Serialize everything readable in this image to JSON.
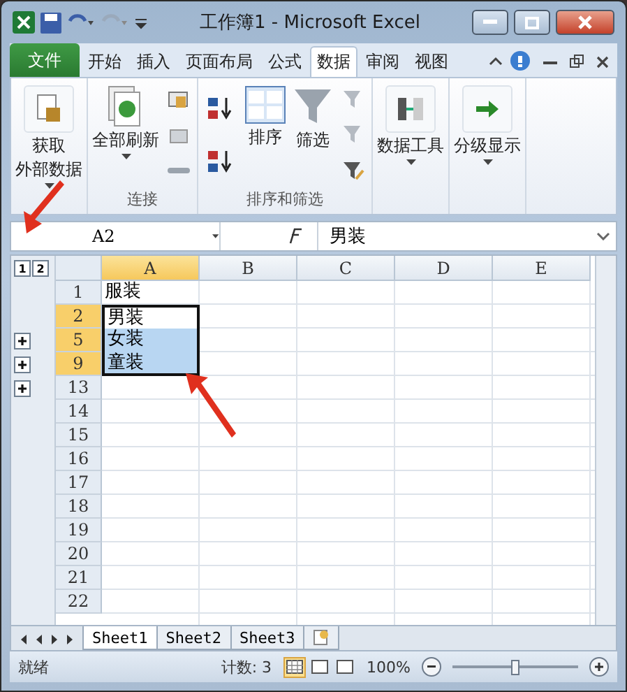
{
  "window": {
    "title": "工作簿1 - Microsoft Excel"
  },
  "file_tab": {
    "label": "文件"
  },
  "tabs": [
    {
      "label": "开始",
      "selected": false
    },
    {
      "label": "插入",
      "selected": false
    },
    {
      "label": "页面布局",
      "selected": false
    },
    {
      "label": "公式",
      "selected": false
    },
    {
      "label": "数据",
      "selected": true
    },
    {
      "label": "审阅",
      "selected": false
    },
    {
      "label": "视图",
      "selected": false
    }
  ],
  "ribbon": {
    "groups": [
      {
        "buttons": [
          {
            "kind": "large",
            "lines": [
              "获取",
              "外部数据"
            ],
            "dropdown": true
          }
        ]
      },
      {
        "label": "连接",
        "buttons": [
          {
            "kind": "large",
            "lines": [
              "全部刷新"
            ],
            "dropdown": true
          },
          {
            "kind": "smallstack"
          }
        ]
      },
      {
        "label": "排序和筛选",
        "buttons": [
          {
            "kind": "sortstack"
          },
          {
            "kind": "large",
            "lines": [
              "排序"
            ],
            "dropdown": false
          },
          {
            "kind": "large",
            "lines": [
              "筛选"
            ],
            "dropdown": false
          },
          {
            "kind": "smallstack"
          }
        ]
      },
      {
        "buttons": [
          {
            "kind": "large",
            "lines": [
              "数据工具"
            ],
            "dropdown": true
          }
        ]
      },
      {
        "buttons": [
          {
            "kind": "large",
            "lines": [
              "分级显示"
            ],
            "dropdown": true
          }
        ]
      }
    ]
  },
  "formula_bar": {
    "name_box": "A2",
    "value": "男装"
  },
  "outline": {
    "levels": [
      "1",
      "2"
    ]
  },
  "columns": [
    {
      "label": "A",
      "selected": true
    },
    {
      "label": "B",
      "selected": false
    },
    {
      "label": "C",
      "selected": false
    },
    {
      "label": "D",
      "selected": false
    },
    {
      "label": "E",
      "selected": false
    }
  ],
  "rows": [
    {
      "label": "1",
      "selected": false,
      "collapsed": false,
      "cell": "服装",
      "cell_selected": false
    },
    {
      "label": "2",
      "selected": true,
      "collapsed": false,
      "cell": "男装",
      "cell_selected": true
    },
    {
      "label": "5",
      "selected": true,
      "collapsed": true,
      "cell": "女装",
      "cell_selected": true
    },
    {
      "label": "9",
      "selected": true,
      "collapsed": true,
      "cell": "童装",
      "cell_selected": true
    },
    {
      "label": "13",
      "selected": false,
      "collapsed": true,
      "cell": "",
      "cell_selected": false
    },
    {
      "label": "14",
      "selected": false,
      "collapsed": false,
      "cell": "",
      "cell_selected": false
    },
    {
      "label": "15",
      "selected": false,
      "collapsed": false,
      "cell": "",
      "cell_selected": false
    },
    {
      "label": "16",
      "selected": false,
      "collapsed": false,
      "cell": "",
      "cell_selected": false
    },
    {
      "label": "17",
      "selected": false,
      "collapsed": false,
      "cell": "",
      "cell_selected": false
    },
    {
      "label": "18",
      "selected": false,
      "collapsed": false,
      "cell": "",
      "cell_selected": false
    },
    {
      "label": "19",
      "selected": false,
      "collapsed": false,
      "cell": "",
      "cell_selected": false
    },
    {
      "label": "20",
      "selected": false,
      "collapsed": false,
      "cell": "",
      "cell_selected": false
    },
    {
      "label": "21",
      "selected": false,
      "collapsed": false,
      "cell": "",
      "cell_selected": false
    },
    {
      "label": "22",
      "selected": false,
      "collapsed": false,
      "cell": "",
      "cell_selected": false
    }
  ],
  "sheets": [
    {
      "label": "Sheet1",
      "selected": true
    },
    {
      "label": "Sheet2",
      "selected": false
    },
    {
      "label": "Sheet3",
      "selected": false
    }
  ],
  "status_bar": {
    "ready": "就绪",
    "count": "计数: 3",
    "views": [
      {
        "selected": true
      },
      {
        "selected": false
      },
      {
        "selected": false
      }
    ],
    "zoom": "100%",
    "zoom_slider": {
      "level": 0.5
    }
  }
}
